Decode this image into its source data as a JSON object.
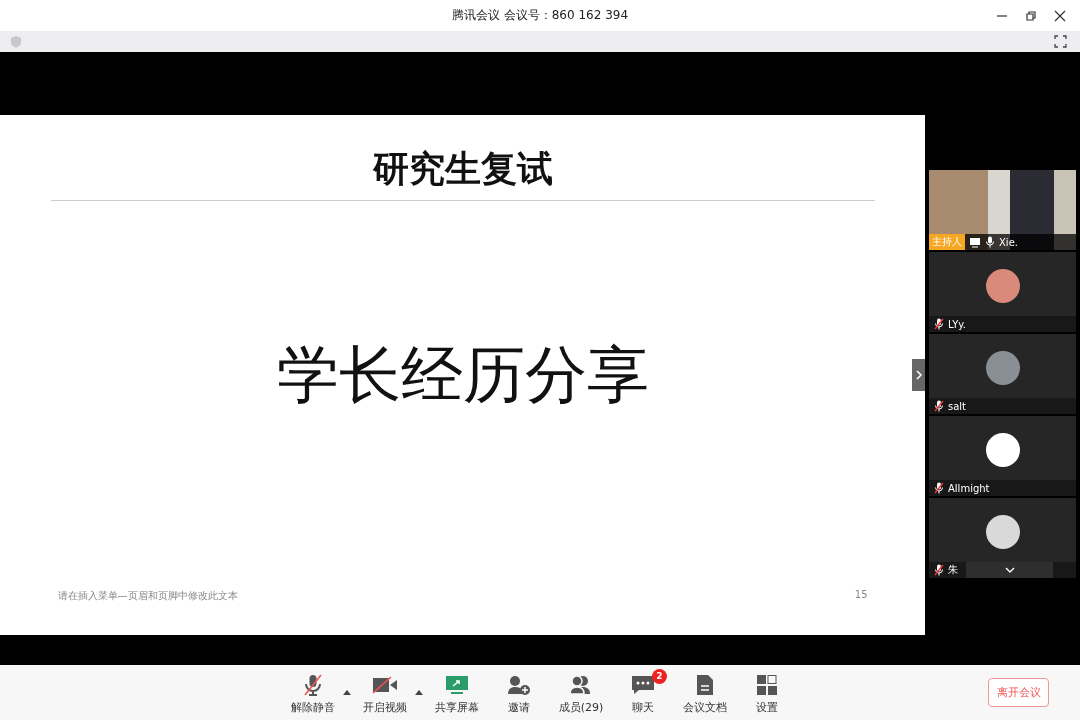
{
  "window": {
    "title": "腾讯会议 会议号：860 162 394"
  },
  "slide": {
    "title": "研究生复试",
    "heading": "学长经历分享",
    "footer": "请在插入菜单—页眉和页脚中修改此文本",
    "page_number": "15"
  },
  "participants": [
    {
      "kind": "video",
      "name": "Xie.",
      "role": "主持人",
      "muted": false,
      "sharing": true
    },
    {
      "kind": "avatar",
      "name": "LYy.",
      "muted": true,
      "color": "#d98a7a"
    },
    {
      "kind": "avatar",
      "name": "salt",
      "muted": true,
      "color": "#8a8f96"
    },
    {
      "kind": "avatar",
      "name": "Allmight",
      "muted": true,
      "color": "#ffffff"
    },
    {
      "kind": "avatar",
      "name": "朱",
      "muted": true,
      "color": "#d9d9d9"
    }
  ],
  "toolbar": [
    {
      "kind": "mic",
      "label": "解除静音",
      "off": true,
      "menu": true
    },
    {
      "kind": "camera",
      "label": "开启视频",
      "off": true,
      "menu": true
    },
    {
      "kind": "share",
      "label": "共享屏幕"
    },
    {
      "kind": "invite",
      "label": "邀请"
    },
    {
      "kind": "members",
      "label": "成员(29)"
    },
    {
      "kind": "chat",
      "label": "聊天",
      "badge": "2"
    },
    {
      "kind": "docs",
      "label": "会议文档"
    },
    {
      "kind": "settings",
      "label": "设置"
    }
  ],
  "leave_button": "离开会议"
}
